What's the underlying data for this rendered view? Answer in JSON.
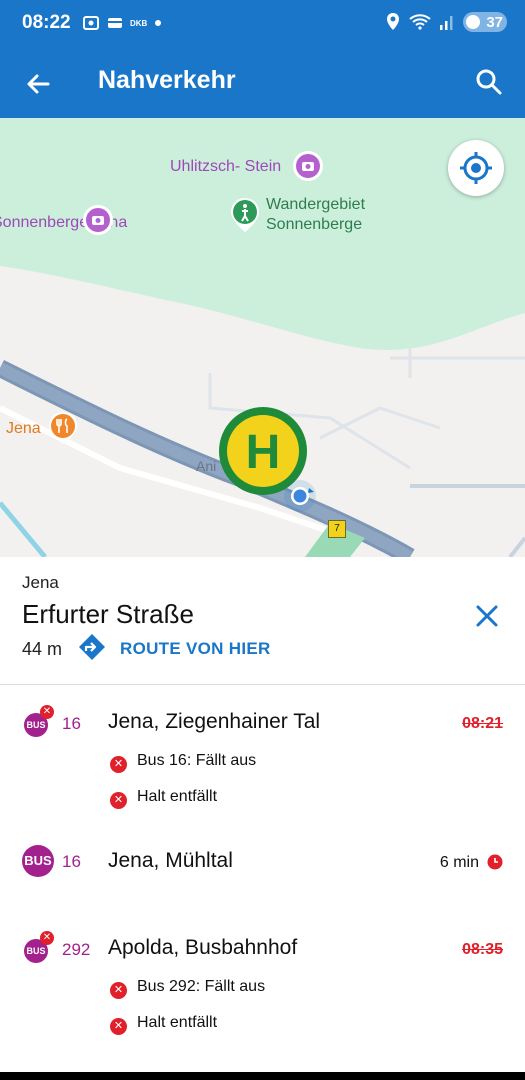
{
  "status_bar": {
    "time": "08:22",
    "left_icons": [
      "screenshot-icon",
      "wallet-icon",
      "dkb-icon",
      "dot-icon"
    ],
    "dkb_label": "DKB",
    "battery": "37"
  },
  "app_bar": {
    "title": "Nahverkehr"
  },
  "map": {
    "labels": {
      "uhlitzsch": "Uhlitzsch- Stein",
      "sonnenberge": "Sonnenberge Jena",
      "wandergebiet": "Wandergebiet Sonnenberge",
      "restaurant": "Jena",
      "street_partial": "Ani",
      "route_shield": "7"
    },
    "stop_sign_letter": "H"
  },
  "stop": {
    "city": "Jena",
    "name": "Erfurter Straße",
    "distance": "44 m",
    "route_label": "ROUTE VON HIER"
  },
  "departures": [
    {
      "badge": "BUS",
      "line": "16",
      "destination": "Jena, Ziegenhainer Tal",
      "time": "08:21",
      "cancelled": true,
      "notices": [
        "Bus 16: Fällt aus",
        "Halt entfällt"
      ]
    },
    {
      "badge": "BUS",
      "line": "16",
      "destination": "Jena, Mühltal",
      "time": "6 min",
      "cancelled": false,
      "notices": []
    },
    {
      "badge": "BUS",
      "line": "292",
      "destination": "Apolda, Busbahnhof",
      "time": "08:35",
      "cancelled": true,
      "notices": [
        "Bus 292: Fällt aus",
        "Halt entfällt"
      ]
    }
  ],
  "colors": {
    "primary": "#1976c9",
    "bus": "#a3218c",
    "alert": "#e0202a",
    "park": "#ccefdc",
    "road": "#8aa1bd",
    "stop_sign_green": "#1f8a3a",
    "stop_sign_yellow": "#f3d21b"
  }
}
